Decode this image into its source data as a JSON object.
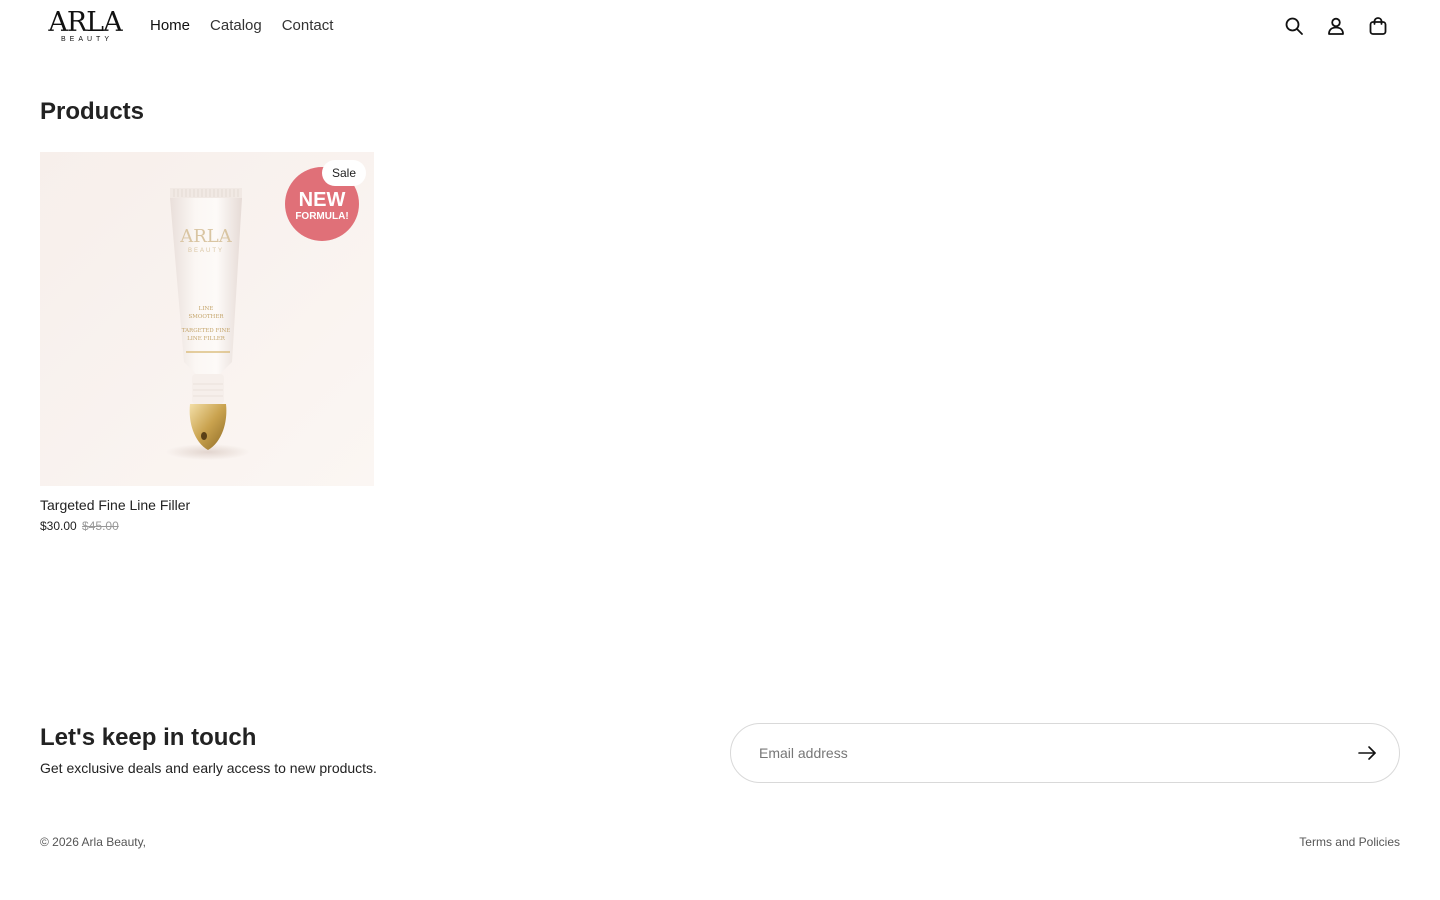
{
  "brand": {
    "logo_main": "ARLA",
    "logo_sub": "BEAUTY"
  },
  "nav": {
    "items": [
      {
        "label": "Home"
      },
      {
        "label": "Catalog"
      },
      {
        "label": "Contact"
      }
    ]
  },
  "header_icons": [
    "search-icon",
    "account-icon",
    "cart-icon"
  ],
  "main": {
    "title": "Products",
    "products": [
      {
        "name": "Targeted Fine Line Filler",
        "price": "$30.00",
        "compare_price": "$45.00",
        "badge": "Sale",
        "image_sticker_line1": "NEW",
        "image_sticker_line2": "FORMULA!",
        "tube_brand": "ARLA",
        "tube_brand_sub": "BEAUTY",
        "tube_text_1": "LINE",
        "tube_text_2": "SMOOTHER",
        "tube_text_3": "TARGETED FINE",
        "tube_text_4": "LINE FILLER"
      }
    ]
  },
  "newsletter": {
    "title": "Let's keep in touch",
    "subtitle": "Get exclusive deals and early access to new products.",
    "email_placeholder": "Email address"
  },
  "footer": {
    "copyright": "© 2026 Arla Beauty,",
    "policies_label": "Terms and Policies"
  },
  "colors": {
    "sticker": "#e07078",
    "image_bg": "#f8f2ef",
    "text": "#222222"
  }
}
